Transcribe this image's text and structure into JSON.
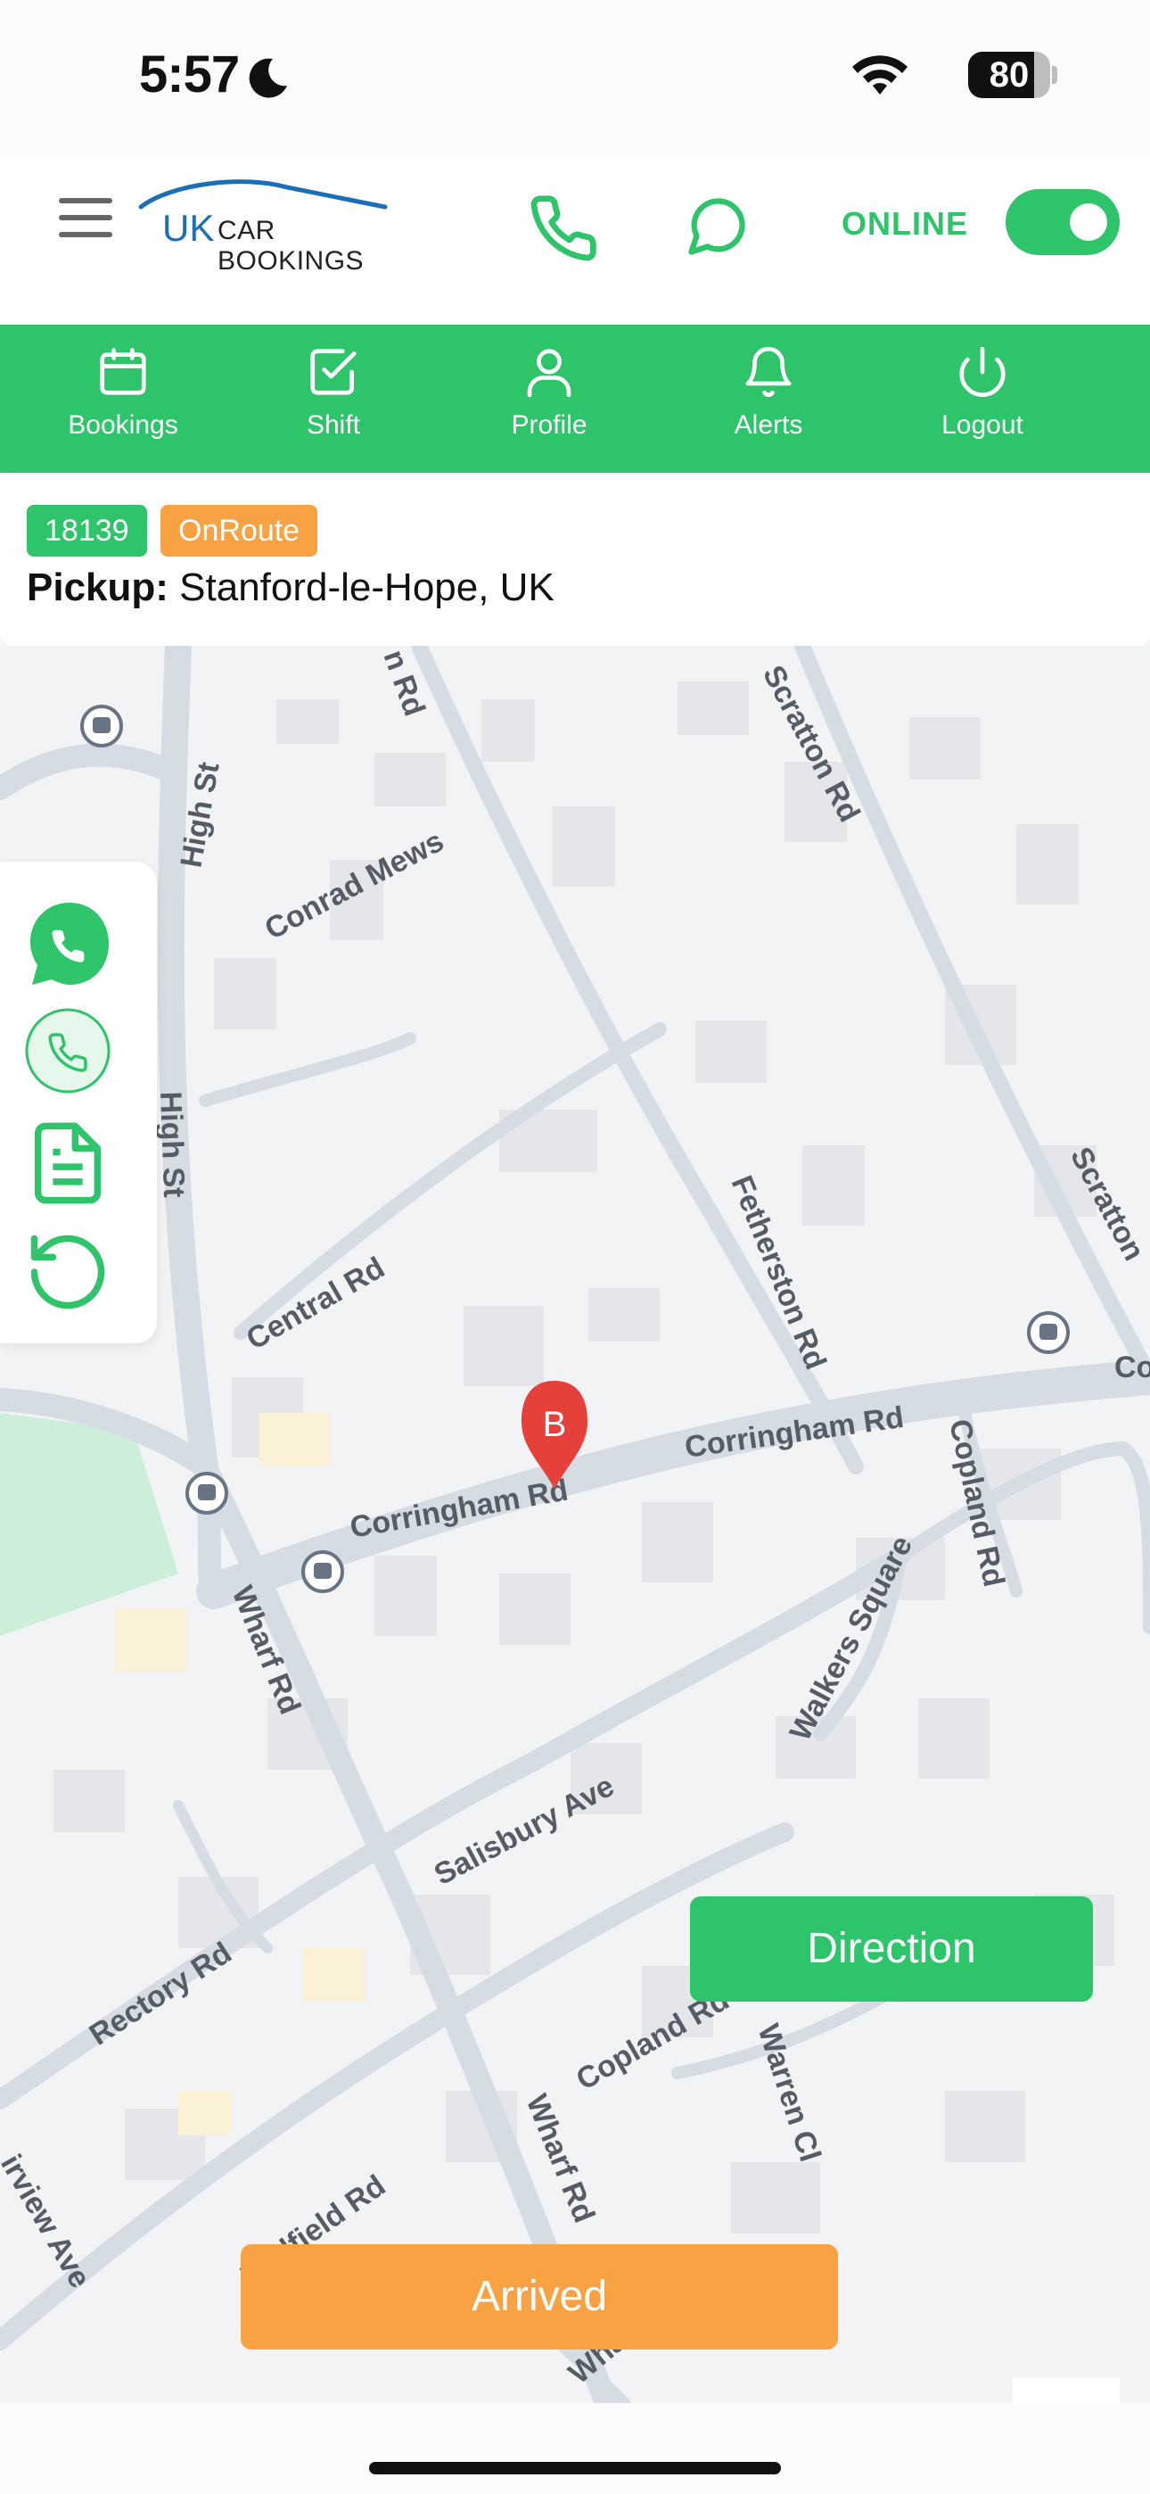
{
  "status_bar": {
    "time": "5:57",
    "battery": "80",
    "battery_level": 0.8
  },
  "header": {
    "logo_primary": "UK",
    "logo_secondary": "CAR BOOKINGS",
    "online_label": "ONLINE",
    "online_toggle": true
  },
  "nav": {
    "items": [
      {
        "label": "Bookings",
        "icon": "calendar-icon"
      },
      {
        "label": "Shift",
        "icon": "checkbox-icon"
      },
      {
        "label": "Profile",
        "icon": "user-icon"
      },
      {
        "label": "Alerts",
        "icon": "bell-icon"
      },
      {
        "label": "Logout",
        "icon": "power-icon"
      }
    ]
  },
  "booking": {
    "id": "18139",
    "status": "OnRoute",
    "pickup_label": "Pickup:",
    "pickup_value": "Stanford-le-Hope, UK"
  },
  "map": {
    "marker_label": "B",
    "streets": [
      "High St",
      "Conrad Mews",
      "Central Rd",
      "Corringham Rd",
      "Wharf Rd",
      "Salisbury Ave",
      "Rectory Rd",
      "Hadfield Rd",
      "Fetherston Rd",
      "Scratton Rd",
      "Scratton",
      "Copland Rd",
      "Walkers Square",
      "Warren Cl",
      "irview Ave",
      "Co",
      "n Rd",
      "Wharf Cl"
    ]
  },
  "side_actions": [
    "whatsapp-icon",
    "phone-call-icon",
    "document-icon",
    "refresh-icon"
  ],
  "actions": {
    "direction": "Direction",
    "arrived": "Arrived"
  },
  "colors": {
    "green": "#2ec46a",
    "orange": "#f9a243"
  }
}
